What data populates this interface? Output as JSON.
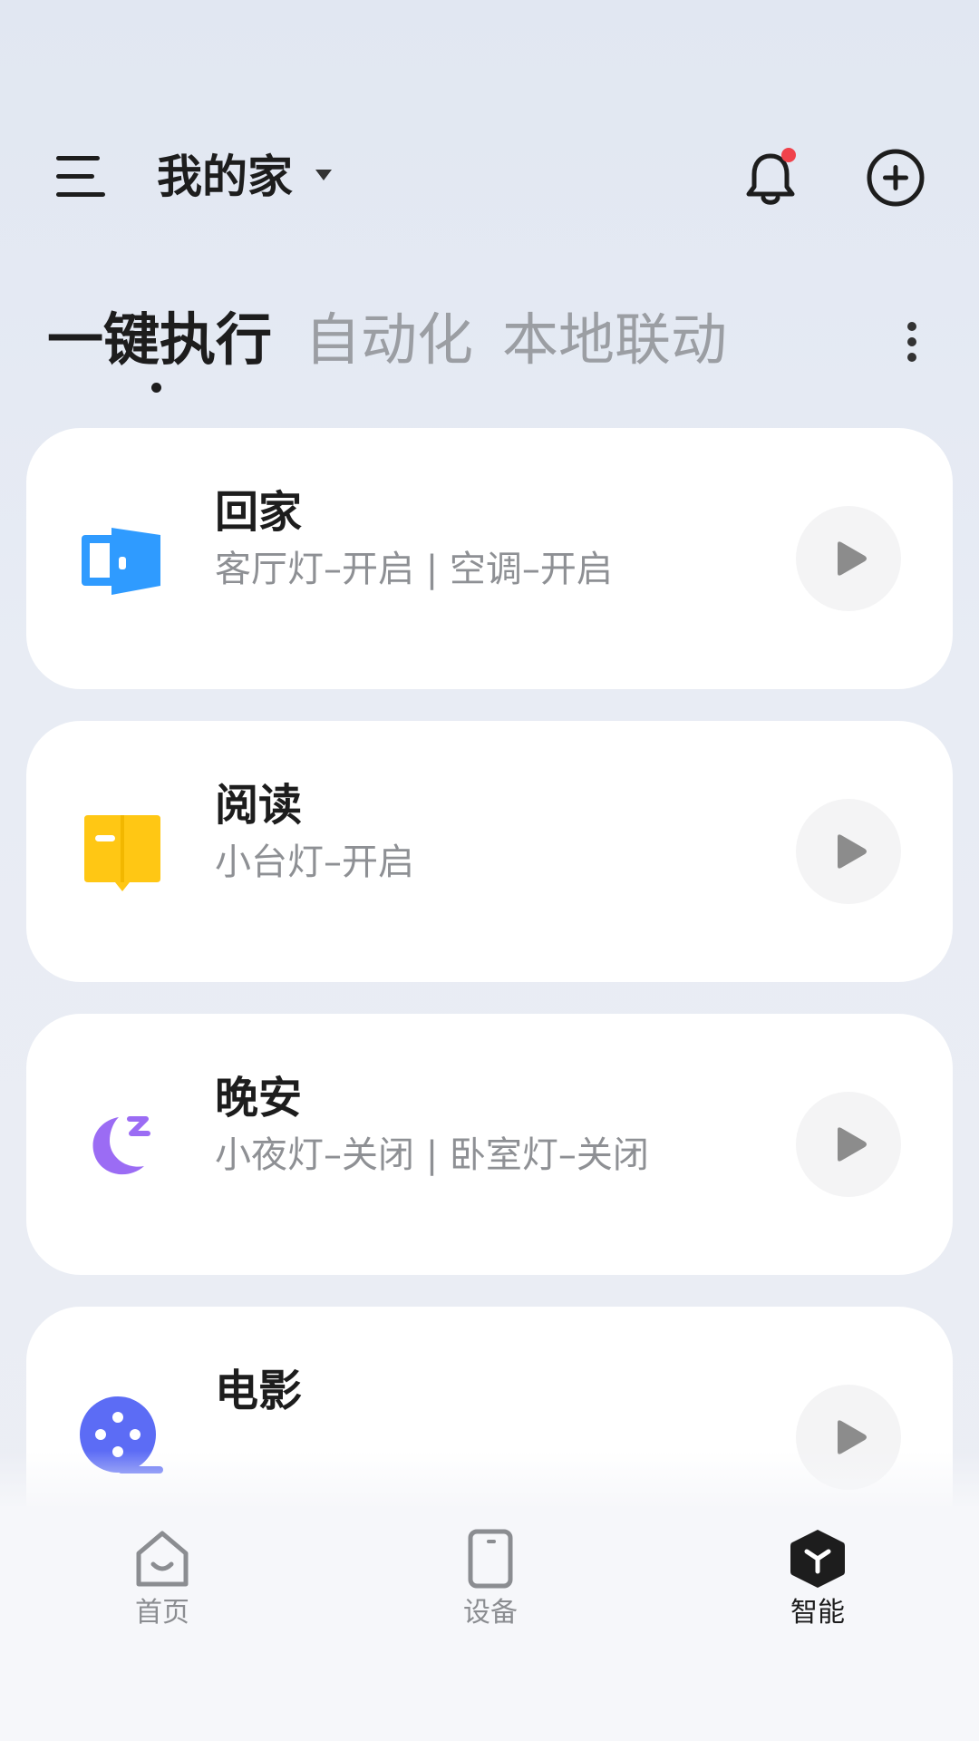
{
  "header": {
    "home_name": "我的家",
    "menu_icon": "menu-icon",
    "notification_icon": "bell-icon",
    "notification_badge_color": "#f0424b",
    "add_icon": "plus-circle-icon"
  },
  "tabs": [
    {
      "label": "一键执行",
      "active": true
    },
    {
      "label": "自动化",
      "active": false
    },
    {
      "label": "本地联动",
      "active": false
    }
  ],
  "scenes": [
    {
      "title": "回家",
      "description": "客厅灯–开启 | 空调–开启",
      "icon": "door-icon",
      "color": "#2f9bff"
    },
    {
      "title": "阅读",
      "description": "小台灯–开启",
      "icon": "book-icon",
      "color": "#ffc714"
    },
    {
      "title": "晚安",
      "description": "小夜灯–关闭 | 卧室灯–关闭",
      "icon": "moon-icon",
      "color": "#9b6cf4"
    },
    {
      "title": "电影",
      "description": "",
      "icon": "film-reel-icon",
      "color": "#5c6cf5"
    }
  ],
  "bottom_nav": [
    {
      "label": "首页",
      "icon": "home-icon",
      "active": false
    },
    {
      "label": "设备",
      "icon": "device-icon",
      "active": false
    },
    {
      "label": "智能",
      "icon": "smart-icon",
      "active": true
    }
  ]
}
